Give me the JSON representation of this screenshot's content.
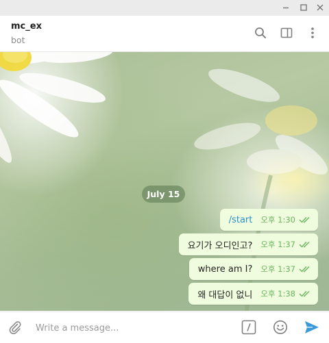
{
  "window": {
    "controls": [
      "minimize-icon",
      "maximize-icon",
      "close-icon"
    ]
  },
  "header": {
    "title": "mc_ex",
    "status": "bot",
    "icons": [
      "search-icon",
      "sidebar-toggle-icon",
      "more-vertical-icon"
    ]
  },
  "chat": {
    "date_label": "July 15",
    "messages": [
      {
        "text": "/start",
        "time": "오후 1:30",
        "is_command": true,
        "read": true
      },
      {
        "text": "요기가 오디인고?",
        "time": "오후 1:37",
        "is_command": false,
        "read": true
      },
      {
        "text": "where am I?",
        "time": "오후 1:37",
        "is_command": false,
        "read": true
      },
      {
        "text": "왜 대답이 없니",
        "time": "오후 1:38",
        "is_command": false,
        "read": true
      }
    ]
  },
  "composer": {
    "placeholder": "Write a message...",
    "value": "",
    "icons": [
      "attach-icon",
      "bot-command-icon",
      "emoji-icon",
      "send-icon"
    ]
  },
  "colors": {
    "accent": "#2e8dc9",
    "outgoing_bubble": "#effdde",
    "read_check": "#6bb35d",
    "send": "#3a9ad9"
  }
}
